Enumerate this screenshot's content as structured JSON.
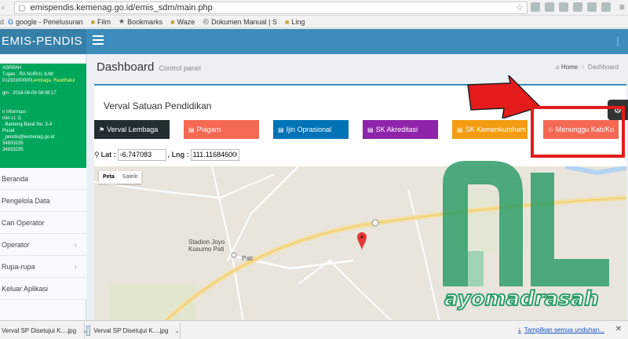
{
  "browser": {
    "url": "emispendis.kemenag.go.id/emis_sdm/main.php",
    "bookmarks": [
      {
        "icon": "google-icon",
        "label": "google - Penelusuran"
      },
      {
        "icon": "folder-icon",
        "label": "Film"
      },
      {
        "icon": "star-icon",
        "label": "Bookmarks"
      },
      {
        "icon": "folder-icon",
        "label": "Waze"
      },
      {
        "icon": "doc-icon",
        "label": "Dokumen Manual | S"
      },
      {
        "icon": "folder-icon",
        "label": "Ling"
      }
    ]
  },
  "app": {
    "logo": "EMIS-PENDIS"
  },
  "sidebar": {
    "user_lines": [
      "ASRPAH",
      "Tugas : RA NURUL ILMI",
      "01233100000",
      "gin : 2018-08-08 08:08:17",
      "n Informasi :",
      "min Lt. 3,",
      ". Banteng Barat No. 3-4",
      "Pusat",
      "_pendis@kemenag.go.id",
      "34833235",
      "34833235"
    ],
    "user_highlight": "Lembaga, Raudhatul",
    "items": [
      {
        "label": "Beranda",
        "has_children": false
      },
      {
        "label": "Pengelola Data",
        "has_children": false
      },
      {
        "label": "Cari Operator",
        "has_children": false
      },
      {
        "label": "Operator",
        "has_children": true
      },
      {
        "label": "Rupa-rupa",
        "has_children": true
      },
      {
        "label": "Keluar Aplikasi",
        "has_children": false
      }
    ]
  },
  "page": {
    "title": "Dashboard",
    "subtitle": "Control panel",
    "breadcrumb_home": "Home",
    "breadcrumb_current": "Dashboard"
  },
  "verval": {
    "title": "Verval Satuan Pendidikan",
    "buttons": [
      {
        "label": "Verval Lembaga",
        "icon": "flag-icon"
      },
      {
        "label": "Piagam",
        "icon": "file-icon"
      },
      {
        "label": "Ijin Oprasional",
        "icon": "file-icon"
      },
      {
        "label": "SK Akreditasi",
        "icon": "file-icon"
      },
      {
        "label": "SK Kemenkumham",
        "icon": "file-icon"
      },
      {
        "label": "Menunggu Kab/Ko",
        "icon": "star-icon"
      }
    ],
    "lat_label": "Lat :",
    "lat_value": "-6.747083",
    "lng_label": ", Lng :",
    "lng_value": "111.116846000"
  },
  "map": {
    "tab_map": "Peta",
    "tab_satellite": "Satelit",
    "labels": {
      "stadium_line1": "Stadion Joyo",
      "stadium_line2": "Kusumo Pati",
      "city": "Pati"
    },
    "colors": {
      "land": "#e9e5dc",
      "road": "#f6df9a",
      "marker": "#e53935"
    }
  },
  "watermark": {
    "text": "ayomadrasah",
    "color": "#2e9e68"
  },
  "downloads": {
    "items": [
      "Verval SP Disetujui K....jpg",
      "Verval SP Disetujui K....jpg"
    ],
    "show_all": "Tampilkan semua unduhan..."
  }
}
